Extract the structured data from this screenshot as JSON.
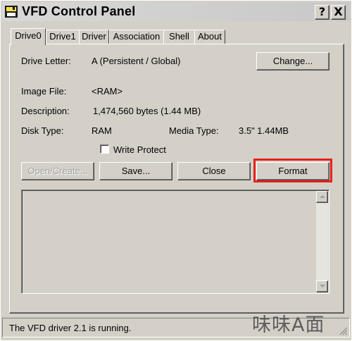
{
  "window": {
    "title": "VFD Control Panel",
    "help_glyph": "?",
    "close_glyph": "X"
  },
  "tabs": [
    {
      "label": "Drive0",
      "active": true
    },
    {
      "label": "Drive1",
      "active": false
    },
    {
      "label": "Driver",
      "active": false
    },
    {
      "label": "Association",
      "active": false
    },
    {
      "label": "Shell",
      "active": false
    },
    {
      "label": "About",
      "active": false
    }
  ],
  "drive": {
    "letter_label": "Drive Letter:",
    "letter_value": "A (Persistent / Global)",
    "change_button": "Change...",
    "image_file_label": "Image File:",
    "image_file_value": "<RAM>",
    "description_label": "Description:",
    "description_value": "1,474,560 bytes (1.44 MB)",
    "disk_type_label": "Disk Type:",
    "disk_type_value": "RAM",
    "media_type_label": "Media Type:",
    "media_type_value": "3.5\"  1.44MB",
    "write_protect_label": "Write Protect",
    "write_protect_checked": false
  },
  "actions": {
    "open_create": "Open/Create...",
    "save": "Save...",
    "close": "Close",
    "format": "Format"
  },
  "log_text": "",
  "status": {
    "text": "The VFD driver 2.1 is running."
  },
  "watermark": "味味A面",
  "colors": {
    "face": "#d4d0c8",
    "highlight_box": "#e8211b"
  }
}
